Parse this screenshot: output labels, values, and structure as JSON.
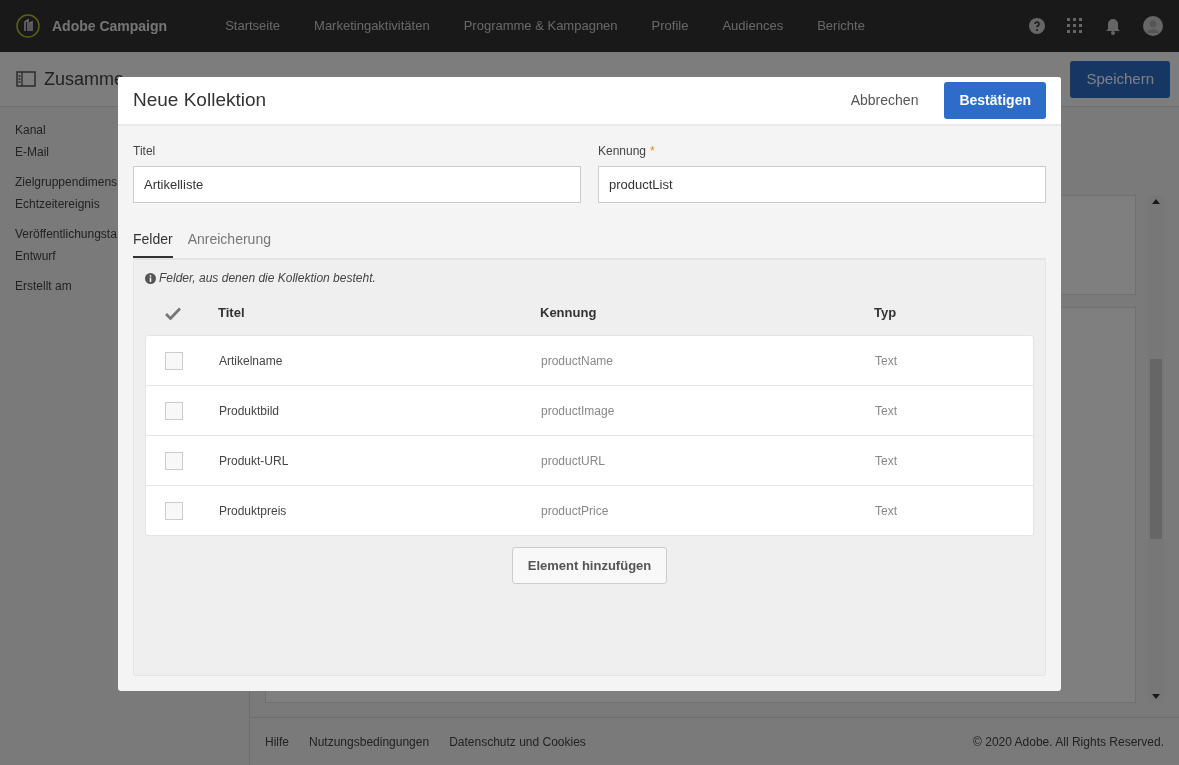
{
  "top_nav": {
    "brand": "Adobe Campaign",
    "items": [
      "Startseite",
      "Marketingaktivitäten",
      "Programme & Kampagnen",
      "Profile",
      "Audiences",
      "Berichte"
    ]
  },
  "page_header": {
    "title": "Zusamme",
    "save": "Speichern"
  },
  "sidebar": {
    "items": [
      {
        "label": "Kanal",
        "value": "E-Mail"
      },
      {
        "label": "Zielgruppendimens",
        "value": "Echtzeitereignis"
      },
      {
        "label": "Veröffentlichungsta",
        "value": "Entwurf"
      },
      {
        "label": "Erstellt am"
      }
    ]
  },
  "dialog": {
    "title": "Neue Kollektion",
    "cancel": "Abbrechen",
    "confirm": "Bestätigen",
    "fields": [
      {
        "label": "Titel",
        "value": "Artikelliste"
      },
      {
        "label": "Kennung",
        "required_mark": "*",
        "value": "productList"
      }
    ],
    "tabs": [
      {
        "label": "Felder",
        "selected": true
      },
      {
        "label": "Anreicherung",
        "selected": false
      }
    ],
    "info": "Felder, aus denen die Kollektion besteht.",
    "table": {
      "columns": [
        "Titel",
        "Kennung",
        "Typ"
      ],
      "rows": [
        {
          "title": "Artikelname",
          "id": "productName",
          "type": "Text",
          "checked": false
        },
        {
          "title": "Produktbild",
          "id": "productImage",
          "type": "Text",
          "checked": false
        },
        {
          "title": "Produkt-URL",
          "id": "productURL",
          "type": "Text",
          "checked": false
        },
        {
          "title": "Produktpreis",
          "id": "productPrice",
          "type": "Text",
          "checked": false
        }
      ]
    },
    "add_button": "Element hinzufügen"
  },
  "footer": {
    "links": [
      "Hilfe",
      "Nutzungsbedingungen",
      "Datenschutz und Cookies"
    ],
    "copyright": "© 2020 Adobe. All Rights Reserved."
  }
}
